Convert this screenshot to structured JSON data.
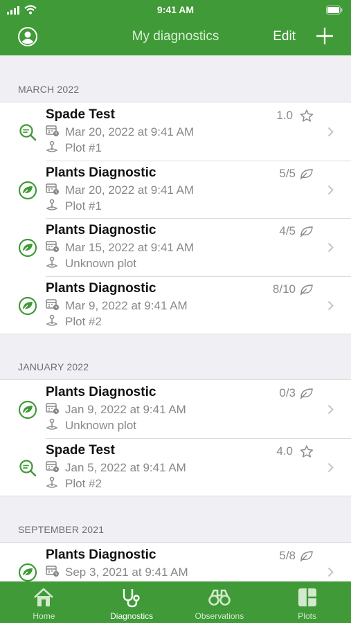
{
  "status_bar": {
    "time": "9:41 AM"
  },
  "nav": {
    "title": "My diagnostics",
    "edit_label": "Edit"
  },
  "colors": {
    "brand_green": "#3f9a37",
    "icon_green": "#3f9a37",
    "muted_text": "#888888"
  },
  "sections": [
    {
      "label": "MARCH 2022",
      "rows": [
        {
          "icon": "spade-test-icon",
          "title": "Spade Test",
          "date": "Mar 20, 2022 at 9:41 AM",
          "plot": "Plot #1",
          "score": "1.0",
          "badge": "star-icon"
        },
        {
          "icon": "leaf-icon",
          "title": "Plants Diagnostic",
          "date": "Mar 20, 2022 at 9:41 AM",
          "plot": "Plot #1",
          "score": "5/5",
          "badge": "leaf-outline-icon"
        },
        {
          "icon": "leaf-icon",
          "title": "Plants Diagnostic",
          "date": "Mar 15, 2022 at 9:41 AM",
          "plot": "Unknown plot",
          "score": "4/5",
          "badge": "leaf-outline-icon"
        },
        {
          "icon": "leaf-icon",
          "title": "Plants Diagnostic",
          "date": "Mar 9, 2022 at 9:41 AM",
          "plot": "Plot #2",
          "score": "8/10",
          "badge": "leaf-outline-icon"
        }
      ]
    },
    {
      "label": "JANUARY 2022",
      "rows": [
        {
          "icon": "leaf-icon",
          "title": "Plants Diagnostic",
          "date": "Jan 9, 2022 at 9:41 AM",
          "plot": "Unknown plot",
          "score": "0/3",
          "badge": "leaf-outline-icon"
        },
        {
          "icon": "spade-test-icon",
          "title": "Spade Test",
          "date": "Jan 5, 2022 at 9:41 AM",
          "plot": "Plot #2",
          "score": "4.0",
          "badge": "star-icon"
        }
      ]
    },
    {
      "label": "SEPTEMBER 2021",
      "rows": [
        {
          "icon": "leaf-icon",
          "title": "Plants Diagnostic",
          "date": "Sep 3, 2021 at 9:41 AM",
          "plot": "",
          "score": "5/8",
          "badge": "leaf-outline-icon"
        }
      ]
    }
  ],
  "tabs": [
    {
      "label": "Home",
      "icon": "home-icon",
      "active": false
    },
    {
      "label": "Diagnostics",
      "icon": "stethoscope-icon",
      "active": true
    },
    {
      "label": "Observations",
      "icon": "binoculars-icon",
      "active": false
    },
    {
      "label": "Plots",
      "icon": "plots-icon",
      "active": false
    }
  ]
}
